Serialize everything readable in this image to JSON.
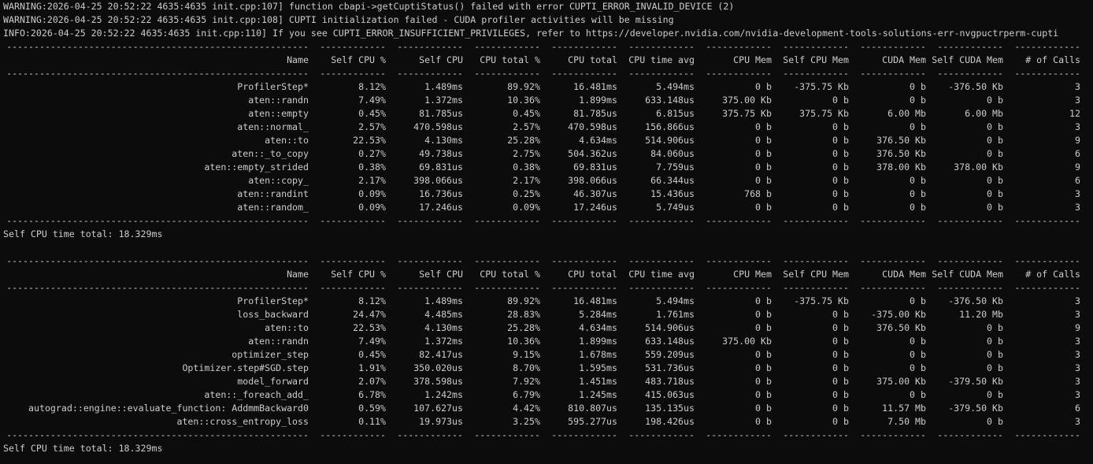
{
  "log": [
    "WARNING:2026-04-25 20:52:22 4635:4635 init.cpp:107] function cbapi->getCuptiStatus() failed with error CUPTI_ERROR_INVALID_DEVICE (2)",
    "WARNING:2026-04-25 20:52:22 4635:4635 init.cpp:108] CUPTI initialization failed - CUDA profiler activities will be missing",
    "INFO:2026-04-25 20:52:22 4635:4635 init.cpp:110] If you see CUPTI_ERROR_INSUFFICIENT_PRIVILEGES, refer to https://developer.nvidia.com/nvidia-development-tools-solutions-err-nvgpuctrperm-cupti"
  ],
  "separator": [
    "-------------------------------------------------------",
    "------------",
    "------------",
    "------------",
    "------------",
    "------------",
    "------------",
    "------------",
    "------------",
    "------------",
    "------------"
  ],
  "headers": [
    "Name",
    "Self CPU %",
    "Self CPU",
    "CPU total %",
    "CPU total",
    "CPU time avg",
    "CPU Mem",
    "Self CPU Mem",
    "CUDA Mem",
    "Self CUDA Mem",
    "# of Calls"
  ],
  "tables": [
    {
      "rows": [
        [
          "ProfilerStep*",
          "8.12%",
          "1.489ms",
          "89.92%",
          "16.481ms",
          "5.494ms",
          "0 b",
          "-375.75 Kb",
          "0 b",
          "-376.50 Kb",
          "3"
        ],
        [
          "aten::randn",
          "7.49%",
          "1.372ms",
          "10.36%",
          "1.899ms",
          "633.148us",
          "375.00 Kb",
          "0 b",
          "0 b",
          "0 b",
          "3"
        ],
        [
          "aten::empty",
          "0.45%",
          "81.785us",
          "0.45%",
          "81.785us",
          "6.815us",
          "375.75 Kb",
          "375.75 Kb",
          "6.00 Mb",
          "6.00 Mb",
          "12"
        ],
        [
          "aten::normal_",
          "2.57%",
          "470.598us",
          "2.57%",
          "470.598us",
          "156.866us",
          "0 b",
          "0 b",
          "0 b",
          "0 b",
          "3"
        ],
        [
          "aten::to",
          "22.53%",
          "4.130ms",
          "25.28%",
          "4.634ms",
          "514.906us",
          "0 b",
          "0 b",
          "376.50 Kb",
          "0 b",
          "9"
        ],
        [
          "aten::_to_copy",
          "0.27%",
          "49.738us",
          "2.75%",
          "504.362us",
          "84.060us",
          "0 b",
          "0 b",
          "376.50 Kb",
          "0 b",
          "6"
        ],
        [
          "aten::empty_strided",
          "0.38%",
          "69.831us",
          "0.38%",
          "69.831us",
          "7.759us",
          "0 b",
          "0 b",
          "378.00 Kb",
          "378.00 Kb",
          "9"
        ],
        [
          "aten::copy_",
          "2.17%",
          "398.066us",
          "2.17%",
          "398.066us",
          "66.344us",
          "0 b",
          "0 b",
          "0 b",
          "0 b",
          "6"
        ],
        [
          "aten::randint",
          "0.09%",
          "16.736us",
          "0.25%",
          "46.307us",
          "15.436us",
          "768 b",
          "0 b",
          "0 b",
          "0 b",
          "3"
        ],
        [
          "aten::random_",
          "0.09%",
          "17.246us",
          "0.09%",
          "17.246us",
          "5.749us",
          "0 b",
          "0 b",
          "0 b",
          "0 b",
          "3"
        ]
      ],
      "total": "Self CPU time total: 18.329ms"
    },
    {
      "rows": [
        [
          "ProfilerStep*",
          "8.12%",
          "1.489ms",
          "89.92%",
          "16.481ms",
          "5.494ms",
          "0 b",
          "-375.75 Kb",
          "0 b",
          "-376.50 Kb",
          "3"
        ],
        [
          "loss_backward",
          "24.47%",
          "4.485ms",
          "28.83%",
          "5.284ms",
          "1.761ms",
          "0 b",
          "0 b",
          "-375.00 Kb",
          "11.20 Mb",
          "3"
        ],
        [
          "aten::to",
          "22.53%",
          "4.130ms",
          "25.28%",
          "4.634ms",
          "514.906us",
          "0 b",
          "0 b",
          "376.50 Kb",
          "0 b",
          "9"
        ],
        [
          "aten::randn",
          "7.49%",
          "1.372ms",
          "10.36%",
          "1.899ms",
          "633.148us",
          "375.00 Kb",
          "0 b",
          "0 b",
          "0 b",
          "3"
        ],
        [
          "optimizer_step",
          "0.45%",
          "82.417us",
          "9.15%",
          "1.678ms",
          "559.209us",
          "0 b",
          "0 b",
          "0 b",
          "0 b",
          "3"
        ],
        [
          "Optimizer.step#SGD.step",
          "1.91%",
          "350.020us",
          "8.70%",
          "1.595ms",
          "531.736us",
          "0 b",
          "0 b",
          "0 b",
          "0 b",
          "3"
        ],
        [
          "model_forward",
          "2.07%",
          "378.598us",
          "7.92%",
          "1.451ms",
          "483.718us",
          "0 b",
          "0 b",
          "375.00 Kb",
          "-379.50 Kb",
          "3"
        ],
        [
          "aten::_foreach_add_",
          "6.78%",
          "1.242ms",
          "6.79%",
          "1.245ms",
          "415.063us",
          "0 b",
          "0 b",
          "0 b",
          "0 b",
          "3"
        ],
        [
          "autograd::engine::evaluate_function: AddmmBackward0",
          "0.59%",
          "107.627us",
          "4.42%",
          "810.807us",
          "135.135us",
          "0 b",
          "0 b",
          "11.57 Mb",
          "-379.50 Kb",
          "6"
        ],
        [
          "aten::cross_entropy_loss",
          "0.11%",
          "19.973us",
          "3.25%",
          "595.277us",
          "198.426us",
          "0 b",
          "0 b",
          "7.50 Mb",
          "0 b",
          "3"
        ]
      ],
      "total": "Self CPU time total: 18.329ms"
    }
  ]
}
